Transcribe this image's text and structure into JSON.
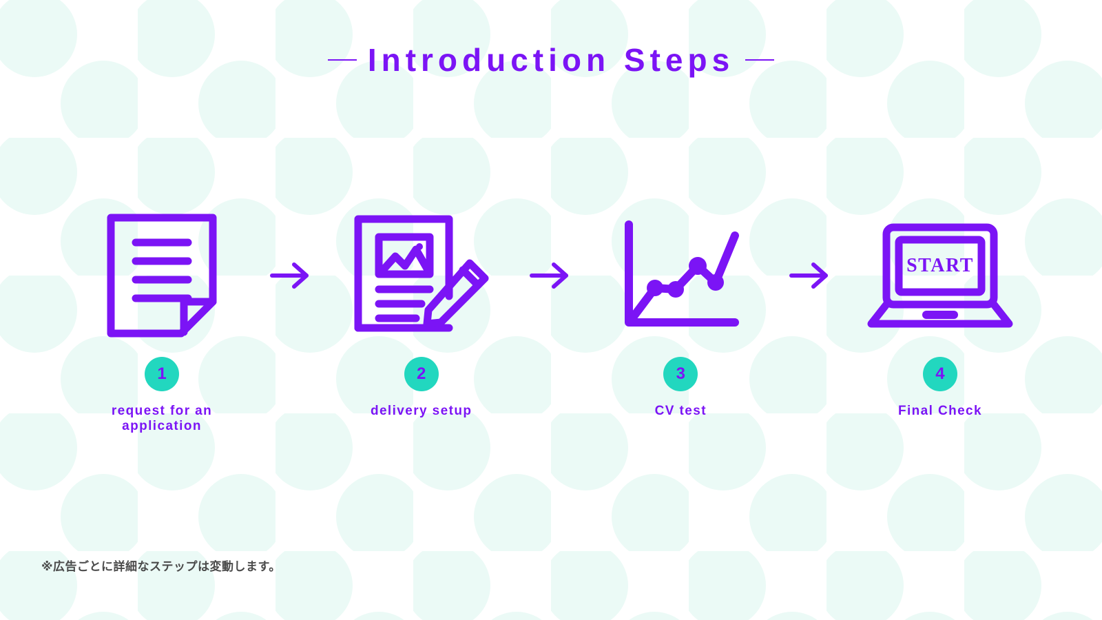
{
  "page": {
    "background_color": "#ffffff",
    "accent_purple": "#7b14f5",
    "accent_teal": "#22d7bf",
    "dot_color": "#eafaf6"
  },
  "header": {
    "title": "Introduction Steps",
    "left_rule": "—",
    "right_rule": "—"
  },
  "steps": [
    {
      "number": "1",
      "label": "request for an\napplication",
      "icon": "document-lines-icon"
    },
    {
      "number": "2",
      "label": "delivery setup",
      "icon": "document-image-pencil-icon"
    },
    {
      "number": "3",
      "label": "CV test",
      "icon": "line-chart-icon"
    },
    {
      "number": "4",
      "label": "Final Check",
      "icon": "laptop-start-icon",
      "screen_text": "START"
    }
  ],
  "arrows": [
    {
      "glyph": "→"
    },
    {
      "glyph": "→"
    },
    {
      "glyph": "→"
    }
  ],
  "footnote": {
    "text": "※広告ごとに詳細なステップは変動します。"
  }
}
